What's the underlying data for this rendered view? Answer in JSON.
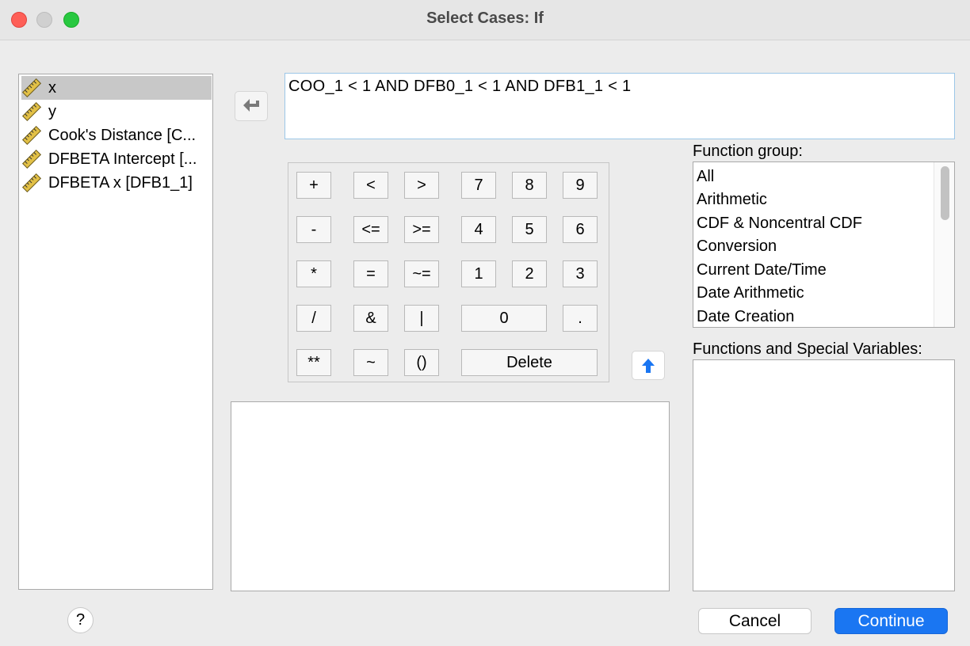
{
  "window": {
    "title": "Select Cases: If"
  },
  "variables": [
    {
      "label": "x",
      "selected": true
    },
    {
      "label": "y",
      "selected": false
    },
    {
      "label": "Cook's Distance [C...",
      "selected": false
    },
    {
      "label": "DFBETA Intercept [...",
      "selected": false
    },
    {
      "label": "DFBETA x [DFB1_1]",
      "selected": false
    }
  ],
  "expression": "COO_1 < 1  AND DFB0_1 < 1 AND DFB1_1 < 1",
  "keypad": {
    "plus": "+",
    "lt": "<",
    "gt": ">",
    "k7": "7",
    "k8": "8",
    "k9": "9",
    "minus": "-",
    "le": "<=",
    "ge": ">=",
    "k4": "4",
    "k5": "5",
    "k6": "6",
    "mult": "*",
    "eq": "=",
    "ne": "~=",
    "k1": "1",
    "k2": "2",
    "k3": "3",
    "div": "/",
    "and": "&",
    "or": "|",
    "k0": "0",
    "dot": ".",
    "pow": "**",
    "not": "~",
    "paren": "()",
    "delete": "Delete"
  },
  "function_group": {
    "label": "Function group:",
    "items": [
      "All",
      "Arithmetic",
      "CDF & Noncentral CDF",
      "Conversion",
      "Current Date/Time",
      "Date Arithmetic",
      "Date Creation"
    ]
  },
  "functions_label": "Functions and Special Variables:",
  "buttons": {
    "help": "?",
    "cancel": "Cancel",
    "continue": "Continue"
  },
  "colors": {
    "accent": "#1a76f2",
    "selection": "#c8c8c8"
  }
}
